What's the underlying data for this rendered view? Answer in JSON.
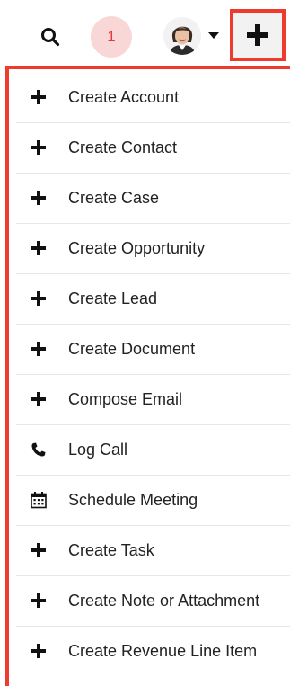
{
  "header": {
    "notification_count": "1"
  },
  "menu": {
    "items": [
      {
        "label": "Create Account",
        "icon": "plus-icon"
      },
      {
        "label": "Create Contact",
        "icon": "plus-icon"
      },
      {
        "label": "Create Case",
        "icon": "plus-icon"
      },
      {
        "label": "Create Opportunity",
        "icon": "plus-icon"
      },
      {
        "label": "Create Lead",
        "icon": "plus-icon"
      },
      {
        "label": "Create Document",
        "icon": "plus-icon"
      },
      {
        "label": "Compose Email",
        "icon": "plus-icon"
      },
      {
        "label": "Log Call",
        "icon": "phone-icon"
      },
      {
        "label": "Schedule Meeting",
        "icon": "calendar-icon"
      },
      {
        "label": "Create Task",
        "icon": "plus-icon"
      },
      {
        "label": "Create Note or Attachment",
        "icon": "plus-icon"
      },
      {
        "label": "Create Revenue Line Item",
        "icon": "plus-icon"
      }
    ]
  },
  "colors": {
    "highlight": "#ef3b2d",
    "badge_bg": "#f9d7d7",
    "badge_text": "#e03b3b"
  }
}
